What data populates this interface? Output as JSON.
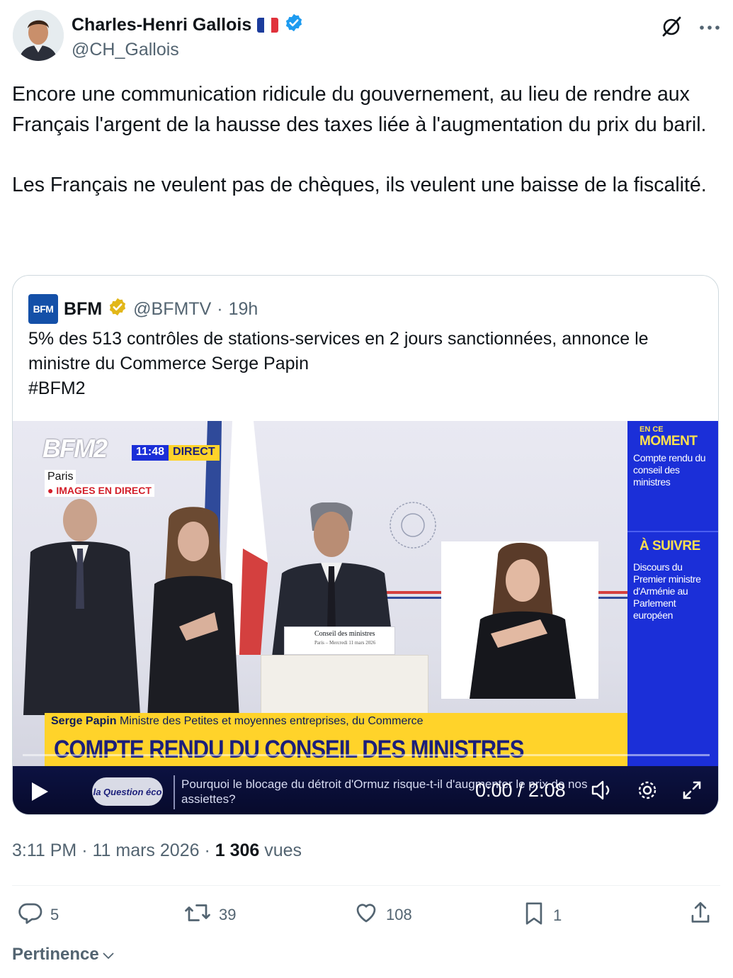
{
  "author": {
    "name": "Charles-Henri Gallois",
    "flag": "🇫🇷",
    "handle": "@CH_Gallois"
  },
  "tweet_text": "Encore une communication ridicule du gouvernement, au lieu de rendre aux Français l'argent de la hausse des taxes liée à l'augmentation du prix du baril.\n\nLes Français ne veulent pas de chèques, ils veulent une baisse de la fiscalité.",
  "quote": {
    "logo_text": "BFM",
    "name": "BFM",
    "handle": "@BFMTV",
    "time": "19h",
    "text": "5% des 513 contrôles de stations-services en 2 jours sanctionnées, annonce le ministre du Commerce Serge Papin\n#BFM2",
    "video": {
      "channel": "BFM2",
      "clock": "11:48",
      "direct": "DIRECT",
      "location": "Paris",
      "live_label": "IMAGES EN DIRECT",
      "en_ce": "EN CE",
      "moment": "MOMENT",
      "moment_text": "Compte rendu du conseil des ministres",
      "a_suivre": "À SUIVRE",
      "a_suivre_text": "Discours du Premier ministre d'Arménie au Parlement européen",
      "lectern_title": "Conseil des ministres",
      "lectern_sub": "Paris – Mercredi 11 mars 2026",
      "speaker_name": "Serge Papin",
      "speaker_role": "Ministre des Petites et moyennes entreprises, du Commerce",
      "headline": "COMPTE RENDU DU CONSEIL DES MINISTRES",
      "ticker_logo": "la Question éco",
      "ticker": "Pourquoi le blocage du détroit d'Ormuz risque-t-il d'augmenter le prix de nos assiettes?",
      "time_display": "0:00 / 2:08",
      "progress": 0
    }
  },
  "meta": {
    "time": "3:11 PM",
    "date": "11 mars 2026",
    "views_count": "1 306",
    "views_label": "vues"
  },
  "actions": {
    "replies": "5",
    "reposts": "39",
    "likes": "108",
    "bookmarks": "1"
  },
  "sort_label": "Pertinence",
  "colors": {
    "verified_blue": "#1d9bf0",
    "verified_gold": "#e2b719",
    "bfm_blue": "#1b2fd8",
    "banner_yellow": "#ffd32a"
  }
}
